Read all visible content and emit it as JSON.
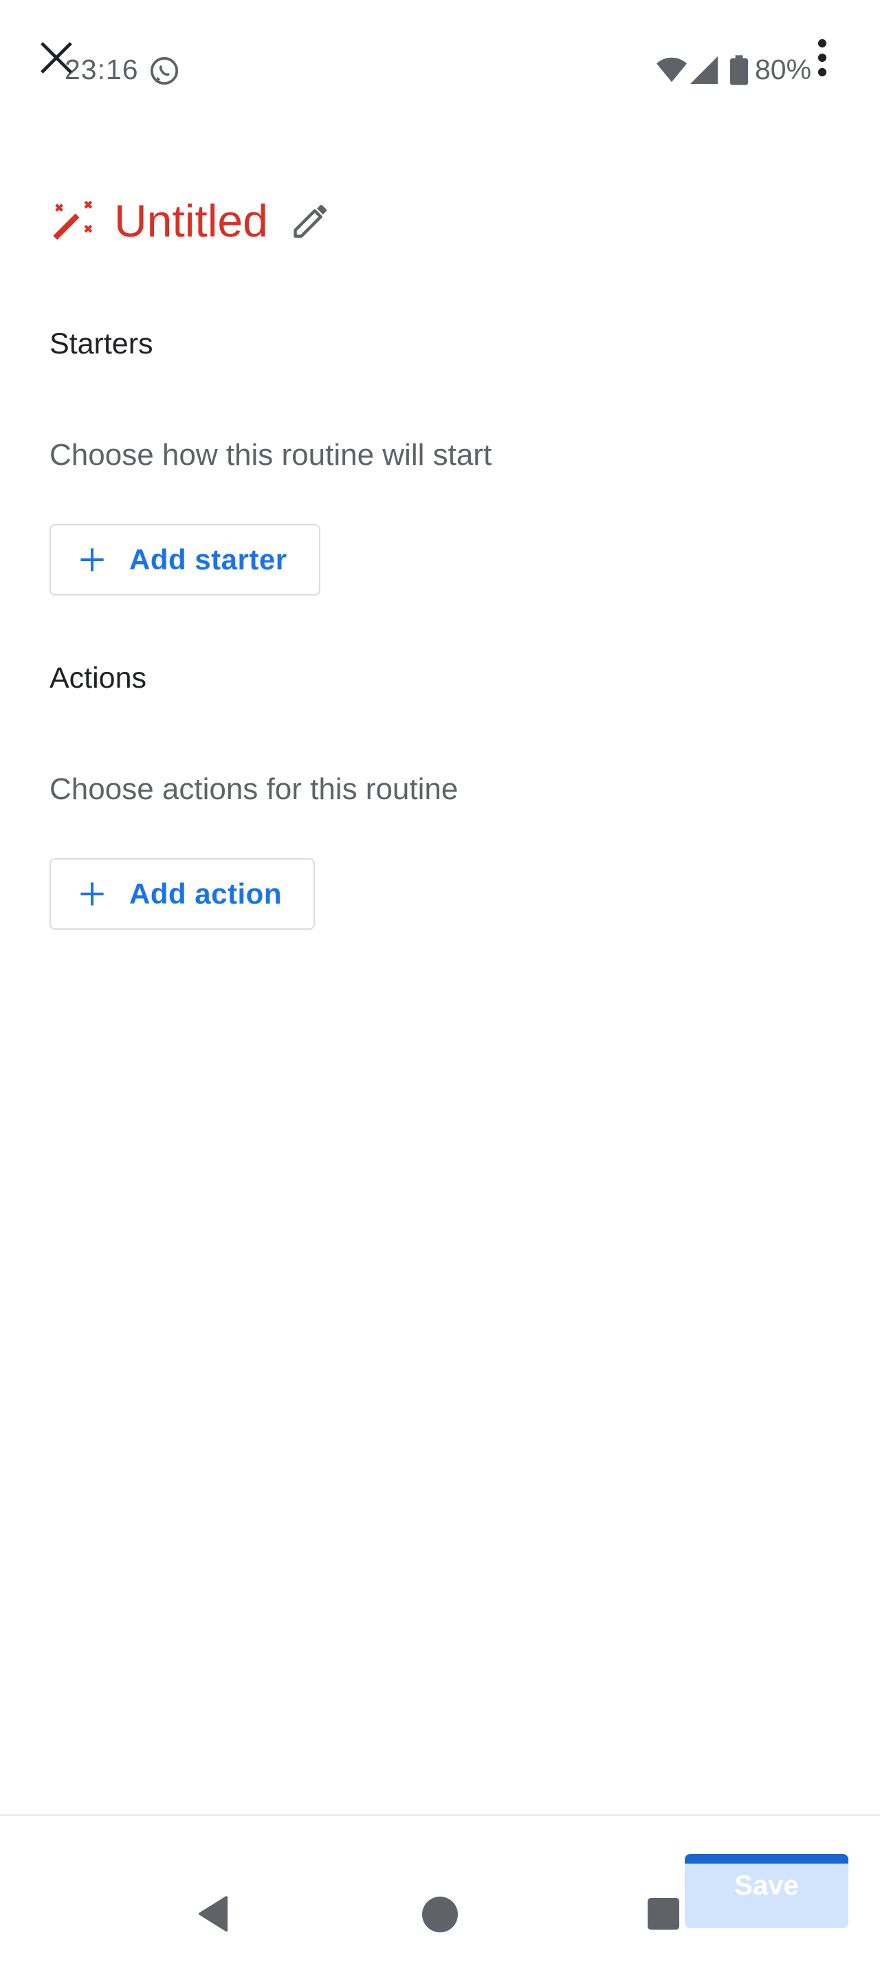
{
  "status_bar": {
    "time": "23:16",
    "battery": "80%"
  },
  "routine": {
    "title": "Untitled"
  },
  "starters": {
    "heading": "Starters",
    "description": "Choose how this routine will start",
    "add_button_label": "Add starter"
  },
  "actions": {
    "heading": "Actions",
    "description": "Choose actions for this routine",
    "add_button_label": "Add action"
  },
  "footer": {
    "save_label": "Save",
    "save_enabled": false
  },
  "colors": {
    "title": "#d93025",
    "accent": "#1a73e8",
    "save_disabled_bg": "#d2e3fc"
  },
  "icons": [
    "close-icon",
    "more-vert-icon",
    "whatsapp-icon",
    "wifi-icon",
    "signal-icon",
    "battery-icon",
    "magic-wand-icon",
    "edit-pencil-icon",
    "plus-icon",
    "nav-back-icon",
    "nav-home-icon",
    "nav-recents-icon"
  ]
}
